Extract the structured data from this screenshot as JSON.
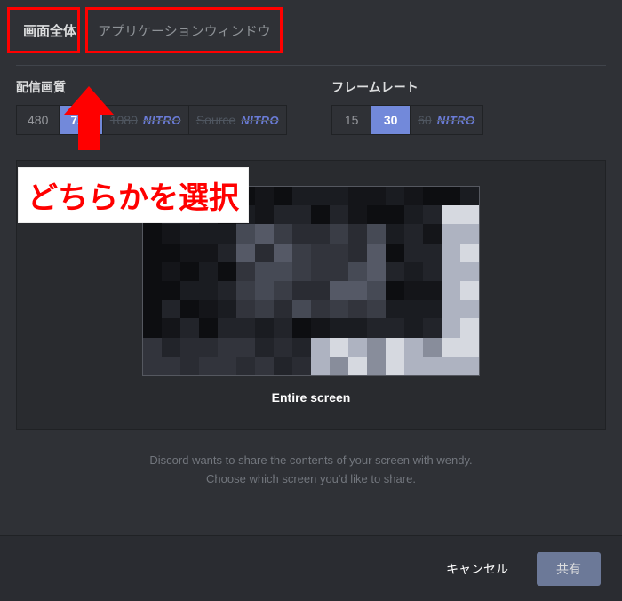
{
  "tabs": {
    "active": "画面全体",
    "inactive": "アプリケーションウィンドウ"
  },
  "quality": {
    "label": "配信画質",
    "options": [
      {
        "text": "480",
        "type": "normal"
      },
      {
        "text": "720",
        "type": "active"
      },
      {
        "text": "1080",
        "type": "nitro",
        "badge": "NITRO"
      },
      {
        "text": "Source",
        "type": "nitro",
        "badge": "NITRO"
      }
    ]
  },
  "fps": {
    "label": "フレームレート",
    "options": [
      {
        "text": "15",
        "type": "normal"
      },
      {
        "text": "30",
        "type": "active"
      },
      {
        "text": "60",
        "type": "nitro",
        "badge": "NITRO"
      }
    ]
  },
  "preview": {
    "caption": "Entire screen"
  },
  "help": {
    "line1": "Discord wants to share the contents of your screen with wendy.",
    "line2": "Choose which screen you'd like to share."
  },
  "footer": {
    "cancel": "キャンセル",
    "share": "共有"
  },
  "annotation": {
    "label": "どちらかを選択"
  }
}
